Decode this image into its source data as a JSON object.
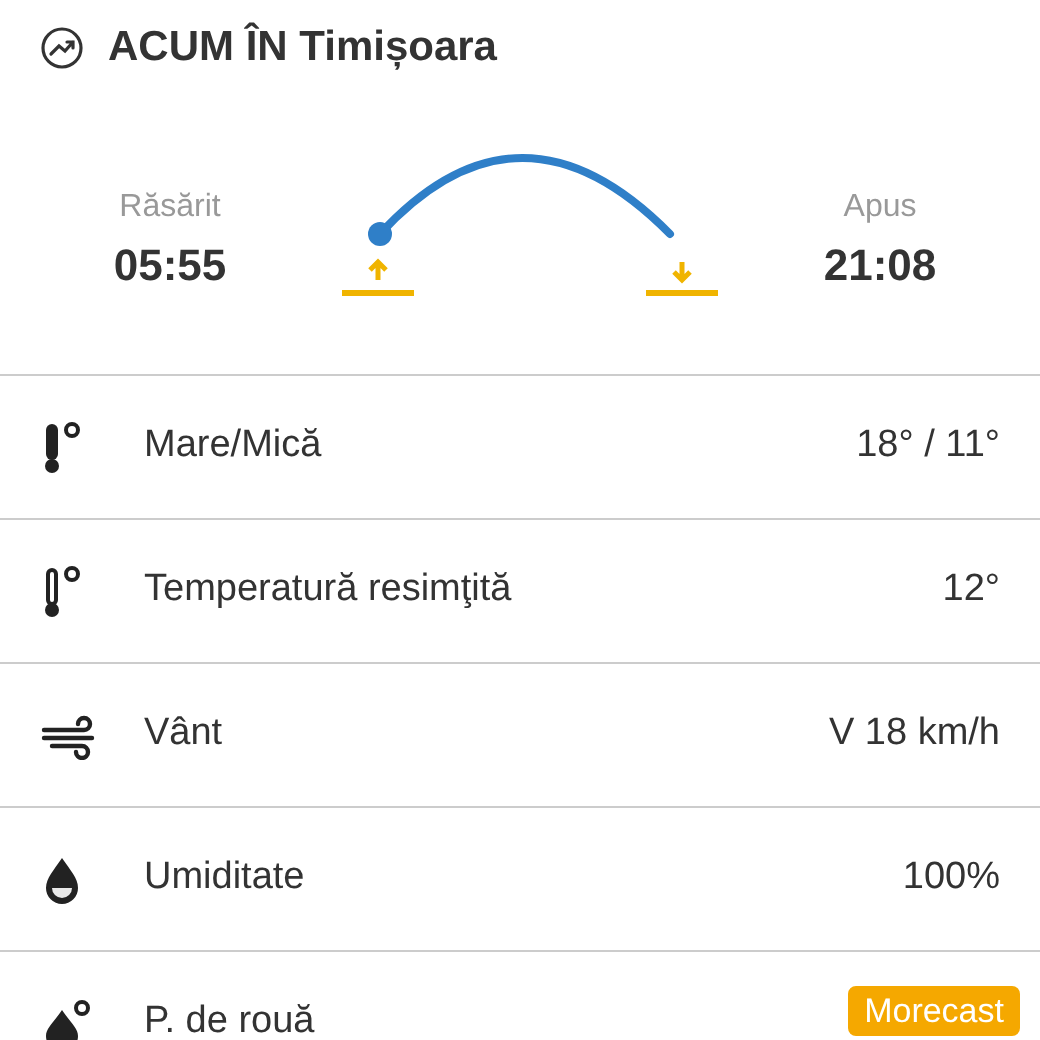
{
  "header": {
    "title": "ACUM ÎN Timișoara"
  },
  "sun": {
    "sunrise_label": "Răsărit",
    "sunrise_time": "05:55",
    "sunset_label": "Apus",
    "sunset_time": "21:08"
  },
  "rows": [
    {
      "kind": "temp",
      "label": "Mare/Mică",
      "value": "18° / 11°"
    },
    {
      "kind": "feels",
      "label": "Temperatură resimţită",
      "value": "12°"
    },
    {
      "kind": "wind",
      "label": "Vânt",
      "value": "V 18 km/h"
    },
    {
      "kind": "humidity",
      "label": "Umiditate",
      "value": "100%"
    },
    {
      "kind": "dew",
      "label": "P. de rouă"
    }
  ],
  "badge": "Morecast"
}
